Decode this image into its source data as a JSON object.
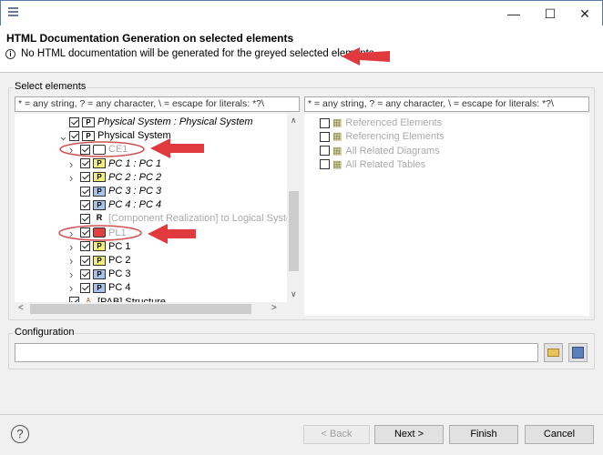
{
  "window": {
    "menu_icon": "menu-icon",
    "minimize": "—",
    "maximize": "☐",
    "close": "✕"
  },
  "header": {
    "title": "HTML Documentation Generation on selected elements",
    "info": "No HTML documentation will be generated for the greyed selected elements."
  },
  "select": {
    "label": "Select elements",
    "left_filter": "* = any string, ? = any character, \\ = escape for literals: *?\\",
    "right_filter": "* = any string, ? = any character, \\ = escape for literals: *?\\",
    "tree": [
      {
        "label": "Physical System : Physical System",
        "checked": true,
        "italic": true,
        "grey": false,
        "icon": "physical-system-icon"
      },
      {
        "label": "Physical System",
        "checked": true,
        "italic": false,
        "grey": false,
        "icon": "physical-system-icon",
        "expanded": true
      },
      {
        "label": "CE1",
        "checked": true,
        "italic": false,
        "grey": true,
        "icon": "component-exchange-icon"
      },
      {
        "label": "PC 1 : PC 1",
        "checked": true,
        "italic": true,
        "grey": false,
        "icon": "physical-component-node-icon"
      },
      {
        "label": "PC 2 : PC 2",
        "checked": true,
        "italic": true,
        "grey": false,
        "icon": "physical-component-node-icon"
      },
      {
        "label": "PC 3 : PC 3",
        "checked": true,
        "italic": true,
        "grey": false,
        "icon": "physical-component-behavior-icon"
      },
      {
        "label": "PC 4 : PC 4",
        "checked": true,
        "italic": true,
        "grey": false,
        "icon": "physical-component-behavior-icon"
      },
      {
        "label": "[Component Realization] to Logical System",
        "checked": true,
        "italic": false,
        "grey": true,
        "icon": "realization-icon"
      },
      {
        "label": "PL1",
        "checked": true,
        "italic": false,
        "grey": true,
        "icon": "physical-link-icon"
      },
      {
        "label": "PC 1",
        "checked": true,
        "italic": false,
        "grey": false,
        "icon": "physical-component-node-icon"
      },
      {
        "label": "PC 2",
        "checked": true,
        "italic": false,
        "grey": false,
        "icon": "physical-component-node-icon"
      },
      {
        "label": "PC 3",
        "checked": true,
        "italic": false,
        "grey": false,
        "icon": "physical-component-behavior-icon"
      },
      {
        "label": "PC 4",
        "checked": true,
        "italic": false,
        "grey": false,
        "icon": "physical-component-behavior-icon"
      },
      {
        "label": "[PAB] Structure",
        "checked": true,
        "italic": false,
        "grey": false,
        "icon": "structure-icon"
      }
    ],
    "options": [
      {
        "label": "Referenced Elements",
        "checked": false
      },
      {
        "label": "Referencing Elements",
        "checked": false
      },
      {
        "label": "All Related Diagrams",
        "checked": false
      },
      {
        "label": "All Related Tables",
        "checked": false
      }
    ]
  },
  "configuration": {
    "label": "Configuration",
    "value": ""
  },
  "buttons": {
    "back": "< Back",
    "next": "Next >",
    "finish": "Finish",
    "cancel": "Cancel",
    "help": "?"
  },
  "colors": {
    "annotation": "#e0393e"
  }
}
